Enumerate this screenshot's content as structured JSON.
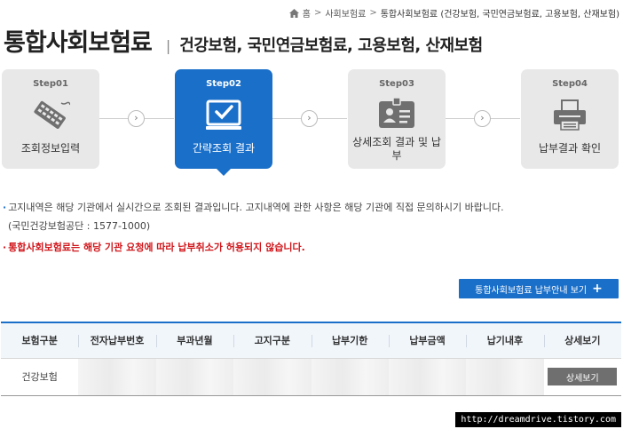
{
  "breadcrumb": {
    "home": "홈",
    "level1": "사회보험료",
    "current": "통합사회보험료 (건강보험, 국민연금보험료, 고용보험, 산재보험)"
  },
  "header": {
    "title": "통합사회보험료",
    "subtitle": "건강보험, 국민연금보험료, 고용보험, 산재보험"
  },
  "steps": [
    {
      "no": "Step01",
      "label": "조회정보입력",
      "icon": "keyboard-icon"
    },
    {
      "no": "Step02",
      "label": "간략조회 결과",
      "icon": "monitor-check-icon"
    },
    {
      "no": "Step03",
      "label": "상세조회 결과 및 납부",
      "icon": "id-card-icon"
    },
    {
      "no": "Step04",
      "label": "납부결과 확인",
      "icon": "printer-icon"
    }
  ],
  "active_step": 2,
  "notices": {
    "line1": "고지내역은 해당 기관에서 실시간으로 조회된 결과입니다. 고지내역에 관한 사항은 해당 기관에 직접 문의하시기 바랍니다.",
    "line2": "(국민건강보험공단 : 1577-1000)",
    "warning": "통합사회보험료는 해당 기관 요청에 따라 납부취소가 허용되지 않습니다."
  },
  "guide_button": "통합사회보험료 납부안내 보기",
  "table": {
    "headers": [
      "보험구분",
      "전자납부번호",
      "부과년월",
      "고지구분",
      "납부기한",
      "납부금액",
      "납기내후",
      "상세보기"
    ],
    "rows": [
      {
        "type": "건강보험",
        "detail_button": "상세보기"
      }
    ]
  },
  "watermark": "http://dreamdrive.tistory.com",
  "colors": {
    "accent": "#1a6fc9",
    "warning": "#d0161b",
    "step_inactive": "#e8e8e8",
    "detail_button": "#6f6f6f"
  }
}
